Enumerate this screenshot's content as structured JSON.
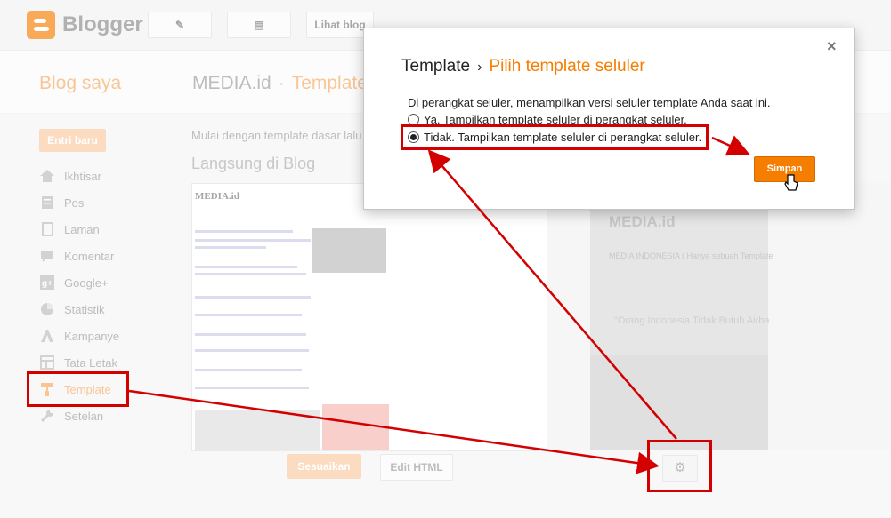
{
  "app": {
    "name": "Blogger"
  },
  "toolbar": {
    "view_blog_label": "Lihat blog"
  },
  "header": {
    "my_blogs": "Blog saya",
    "blog_name": "MEDIA.id",
    "separator": "·",
    "section": "Template"
  },
  "sidebar": {
    "new_post_label": "Entri baru",
    "items": [
      {
        "label": "Ikhtisar",
        "icon": "home-icon"
      },
      {
        "label": "Pos",
        "icon": "posts-icon"
      },
      {
        "label": "Laman",
        "icon": "pages-icon"
      },
      {
        "label": "Komentar",
        "icon": "comments-icon"
      },
      {
        "label": "Google+",
        "icon": "google-plus-icon"
      },
      {
        "label": "Statistik",
        "icon": "stats-icon"
      },
      {
        "label": "Kampanye",
        "icon": "campaign-icon"
      },
      {
        "label": "Tata Letak",
        "icon": "layout-icon"
      },
      {
        "label": "Template",
        "icon": "paint-roller-icon",
        "active": true
      },
      {
        "label": "Setelan",
        "icon": "wrench-icon"
      }
    ]
  },
  "main": {
    "intro": "Mulai dengan template dasar lalu",
    "live_heading": "Langsung di Blog",
    "preview": {
      "blog_title": "MEDIA.id"
    },
    "mobile_preview": {
      "blog_title": "MEDIA.id",
      "description": "MEDIA INDONESIA ( Hanya sebuah Template",
      "quote": "\"Orang Indonesia Tidak Butuh Airba"
    },
    "customize_label": "Sesuaikan",
    "edit_html_label": "Edit HTML"
  },
  "dialog": {
    "close_glyph": "×",
    "title": "Template",
    "arrow": "›",
    "subtitle": "Pilih template seluler",
    "description": "Di perangkat seluler, menampilkan versi seluler template Anda saat ini.",
    "option_yes": "Ya. Tampilkan template seluler di perangkat seluler.",
    "option_no": "Tidak. Tampilkan template seluler di perangkat seluler.",
    "selected": "option_no",
    "save_label": "Simpan"
  },
  "colors": {
    "accent": "#f57d00",
    "annotation": "#d40000"
  }
}
